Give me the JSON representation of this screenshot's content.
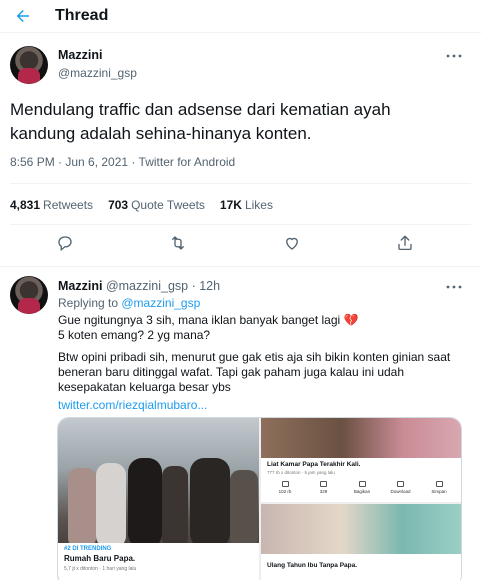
{
  "header": {
    "title": "Thread"
  },
  "tweet": {
    "name": "Mazzini",
    "handle": "@mazzini_gsp",
    "text": "Mendulang traffic dan adsense dari kematian ayah kandung adalah sehina-hinanya konten.",
    "meta": "8:56 PM · Jun 6, 2021 · Twitter for Android",
    "retweets_count": "4,831",
    "retweets_label": "Retweets",
    "quotes_count": "703",
    "quotes_label": "Quote Tweets",
    "likes_count": "17K",
    "likes_label": "Likes"
  },
  "reply": {
    "name": "Mazzini",
    "handle": "@mazzini_gsp",
    "time": "· 12h",
    "replying_prefix": "Replying to ",
    "replying_handle": "@mazzini_gsp",
    "lines": [
      "Gue ngitungnya 3 sih, mana iklan banyak banget lagi 💔",
      "5 koten emang? 2 yg mana?",
      "Btw opini pribadi sih, menurut gue gak etis aja sih bikin konten ginian saat",
      "beneran baru ditinggal wafat. Tapi gak paham juga kalau ini udah",
      "kesepakatan keluarga besar ybs"
    ],
    "link": "twitter.com/riezqialmubaro..."
  },
  "media": {
    "left_tag": "#2 DI TRENDING",
    "left_title": "Rumah Baru Papa.",
    "left_sub": "5,7 jt x ditonton · 1 hari yang lalu",
    "right_top_title": "Liat Kamar Papa Terakhir Kali.",
    "right_top_sub": "777 rb x ditonton · 5 jam yang lalu",
    "right_top_buttons": [
      "102 rb",
      "329",
      "Bagikan",
      "Download",
      "Simpan"
    ],
    "right_bottom_title": "Ulang Tahun Ibu Tanpa Papa."
  },
  "icons": {
    "back": "back-arrow-icon",
    "more": "more-icon",
    "reply": "reply-icon",
    "retweet": "retweet-icon",
    "like": "like-icon",
    "share": "share-icon"
  },
  "colors": {
    "accent": "#1d9bf0",
    "muted": "#536471"
  }
}
